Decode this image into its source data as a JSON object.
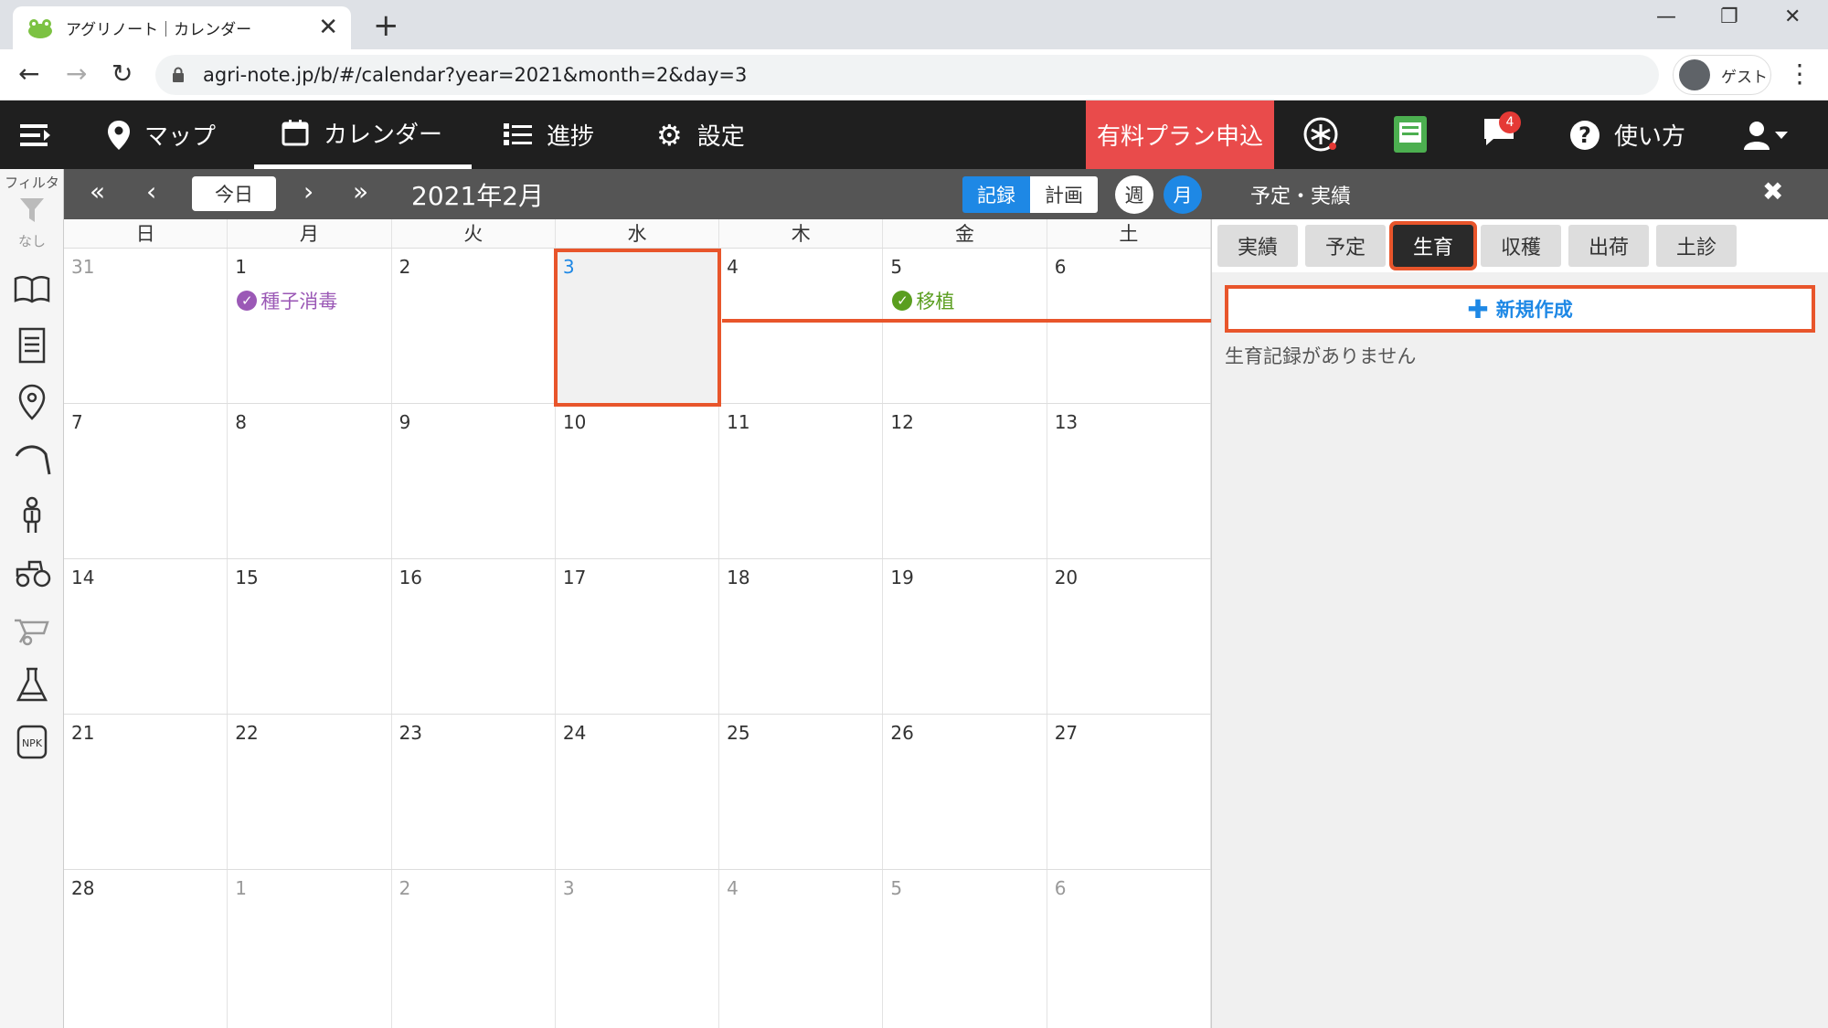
{
  "browser": {
    "tab_title": "アグリノート｜カレンダー",
    "url": "agri-note.jp/b/#/calendar?year=2021&month=2&day=3",
    "profile_label": "ゲスト"
  },
  "header": {
    "nav": [
      {
        "label": "マップ",
        "icon": "map-pin-icon"
      },
      {
        "label": "カレンダー",
        "icon": "calendar-icon",
        "active": true
      },
      {
        "label": "進捗",
        "icon": "checklist-icon"
      },
      {
        "label": "設定",
        "icon": "gear-icon"
      }
    ],
    "plan_button": "有料プラン申込",
    "notification_count": "4",
    "help_label": "使い方"
  },
  "sidebar": {
    "filter_label": "フィルタ",
    "filter_value": "なし",
    "icons": [
      "book-icon",
      "document-icon",
      "location-icon",
      "sickle-icon",
      "worker-icon",
      "tractor-icon",
      "wheelbarrow-icon",
      "flask-icon",
      "npk-fertilizer-icon"
    ]
  },
  "toolbar": {
    "today": "今日",
    "month_title": "2021年2月",
    "record": "記録",
    "plan": "計画",
    "week": "週",
    "month": "月",
    "panel_title": "予定・実績"
  },
  "calendar": {
    "weekdays": [
      "日",
      "月",
      "火",
      "水",
      "木",
      "金",
      "土"
    ],
    "weeks": [
      [
        "31",
        "1",
        "2",
        "3",
        "4",
        "5",
        "6"
      ],
      [
        "7",
        "8",
        "9",
        "10",
        "11",
        "12",
        "13"
      ],
      [
        "14",
        "15",
        "16",
        "17",
        "18",
        "19",
        "20"
      ],
      [
        "21",
        "22",
        "23",
        "24",
        "25",
        "26",
        "27"
      ],
      [
        "28",
        "1",
        "2",
        "3",
        "4",
        "5",
        "6"
      ]
    ],
    "events": [
      {
        "label": "種子消毒",
        "color": "#9b59b6"
      },
      {
        "label": "移植",
        "color": "#5a9e1f"
      }
    ]
  },
  "panel": {
    "tabs": [
      "実績",
      "予定",
      "生育",
      "収穫",
      "出荷",
      "土診"
    ],
    "active_tab": "生育",
    "new_button": "新規作成",
    "empty_message": "生育記録がありません"
  },
  "colors": {
    "accent": "#1e88e5",
    "highlight": "#e8552b",
    "plan_button": "#e94b4b"
  }
}
